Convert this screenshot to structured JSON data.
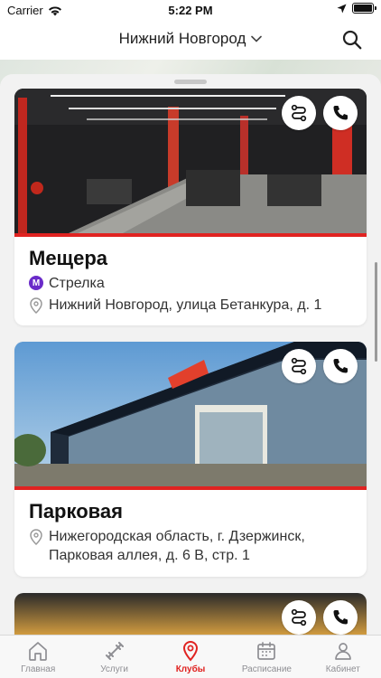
{
  "status": {
    "carrier": "Carrier",
    "time": "5:22 PM"
  },
  "header": {
    "city": "Нижний Новгород"
  },
  "clubs": [
    {
      "name": "Мещера",
      "metro": "Стрелка",
      "metro_badge": "М",
      "address": "Нижний Новгород, улица Бетанкура, д. 1"
    },
    {
      "name": "Парковая",
      "address": "Нижегородская область, г. Дзержинск, Парковая аллея, д. 6 В, стр. 1"
    }
  ],
  "tabs": [
    {
      "label": "Главная",
      "icon": "home-icon"
    },
    {
      "label": "Услуги",
      "icon": "dumbbell-icon"
    },
    {
      "label": "Клубы",
      "icon": "map-pin-icon",
      "active": true
    },
    {
      "label": "Расписание",
      "icon": "calendar-icon"
    },
    {
      "label": "Кабинет",
      "icon": "user-icon"
    }
  ],
  "colors": {
    "accent": "#e02321",
    "metro": "#6a2bc9"
  }
}
